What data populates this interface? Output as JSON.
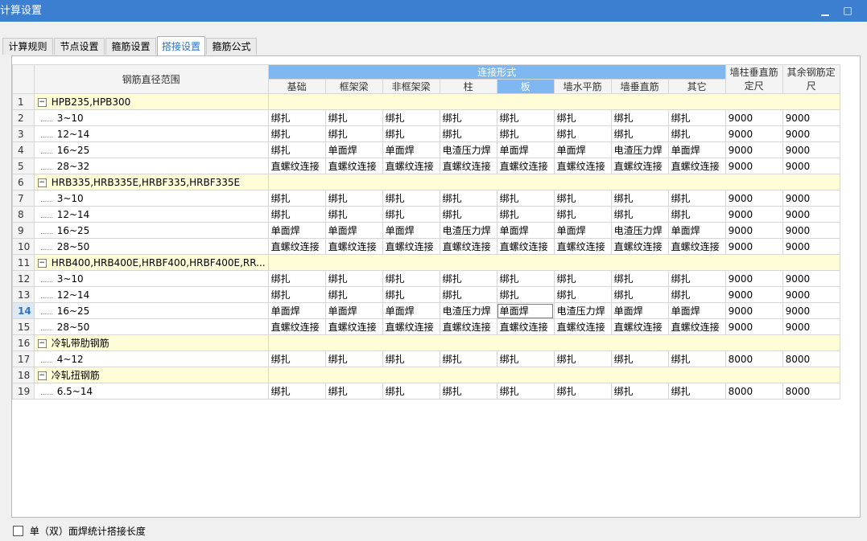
{
  "window": {
    "title": "计算设置",
    "minimize": "▁",
    "maximize": "□"
  },
  "tabs": [
    {
      "label": "计算规则",
      "active": false
    },
    {
      "label": "节点设置",
      "active": false
    },
    {
      "label": "箍筋设置",
      "active": false
    },
    {
      "label": "搭接设置",
      "active": true
    },
    {
      "label": "箍筋公式",
      "active": false
    }
  ],
  "table": {
    "header_range": "钢筋直径范围",
    "header_group": "连接形式",
    "columns": [
      "基础",
      "框架梁",
      "非框架梁",
      "柱",
      "板",
      "墙水平筋",
      "墙垂直筋",
      "其它"
    ],
    "col_wall_vertical_len": "墙柱垂直筋定尺",
    "col_other_len": "其余钢筋定尺",
    "rows": [
      {
        "num": "1",
        "group": true,
        "name": "HPB235,HPB300"
      },
      {
        "num": "2",
        "name": "3~10",
        "cells": [
          "绑扎",
          "绑扎",
          "绑扎",
          "绑扎",
          "绑扎",
          "绑扎",
          "绑扎",
          "绑扎",
          "9000",
          "9000"
        ]
      },
      {
        "num": "3",
        "name": "12~14",
        "cells": [
          "绑扎",
          "绑扎",
          "绑扎",
          "绑扎",
          "绑扎",
          "绑扎",
          "绑扎",
          "绑扎",
          "9000",
          "9000"
        ]
      },
      {
        "num": "4",
        "name": "16~25",
        "cells": [
          "绑扎",
          "单面焊",
          "单面焊",
          "电渣压力焊",
          "单面焊",
          "单面焊",
          "电渣压力焊",
          "单面焊",
          "9000",
          "9000"
        ]
      },
      {
        "num": "5",
        "name": "28~32",
        "cells": [
          "直螺纹连接",
          "直螺纹连接",
          "直螺纹连接",
          "直螺纹连接",
          "直螺纹连接",
          "直螺纹连接",
          "直螺纹连接",
          "直螺纹连接",
          "9000",
          "9000"
        ]
      },
      {
        "num": "6",
        "group": true,
        "name": "HRB335,HRB335E,HRBF335,HRBF335E"
      },
      {
        "num": "7",
        "name": "3~10",
        "cells": [
          "绑扎",
          "绑扎",
          "绑扎",
          "绑扎",
          "绑扎",
          "绑扎",
          "绑扎",
          "绑扎",
          "9000",
          "9000"
        ]
      },
      {
        "num": "8",
        "name": "12~14",
        "cells": [
          "绑扎",
          "绑扎",
          "绑扎",
          "绑扎",
          "绑扎",
          "绑扎",
          "绑扎",
          "绑扎",
          "9000",
          "9000"
        ]
      },
      {
        "num": "9",
        "name": "16~25",
        "cells": [
          "单面焊",
          "单面焊",
          "单面焊",
          "电渣压力焊",
          "单面焊",
          "单面焊",
          "电渣压力焊",
          "单面焊",
          "9000",
          "9000"
        ]
      },
      {
        "num": "10",
        "name": "28~50",
        "cells": [
          "直螺纹连接",
          "直螺纹连接",
          "直螺纹连接",
          "直螺纹连接",
          "直螺纹连接",
          "直螺纹连接",
          "直螺纹连接",
          "直螺纹连接",
          "9000",
          "9000"
        ]
      },
      {
        "num": "11",
        "group": true,
        "name": "HRB400,HRB400E,HRBF400,HRBF400E,RR..."
      },
      {
        "num": "12",
        "name": "3~10",
        "cells": [
          "绑扎",
          "绑扎",
          "绑扎",
          "绑扎",
          "绑扎",
          "绑扎",
          "绑扎",
          "绑扎",
          "9000",
          "9000"
        ]
      },
      {
        "num": "13",
        "name": "12~14",
        "cells": [
          "绑扎",
          "绑扎",
          "绑扎",
          "绑扎",
          "绑扎",
          "绑扎",
          "绑扎",
          "绑扎",
          "9000",
          "9000"
        ]
      },
      {
        "num": "14",
        "name": "16~25",
        "active": true,
        "cells": [
          "单面焊",
          "单面焊",
          "单面焊",
          "电渣压力焊",
          "单面焊",
          "电渣压力焊",
          "单面焊",
          "单面焊",
          "9000",
          "9000"
        ]
      },
      {
        "num": "15",
        "name": "28~50",
        "cells": [
          "直螺纹连接",
          "直螺纹连接",
          "直螺纹连接",
          "直螺纹连接",
          "直螺纹连接",
          "直螺纹连接",
          "直螺纹连接",
          "直螺纹连接",
          "9000",
          "9000"
        ]
      },
      {
        "num": "16",
        "group": true,
        "name": "冷轧带肋钢筋"
      },
      {
        "num": "17",
        "name": "4~12",
        "cells": [
          "绑扎",
          "绑扎",
          "绑扎",
          "绑扎",
          "绑扎",
          "绑扎",
          "绑扎",
          "绑扎",
          "8000",
          "8000"
        ]
      },
      {
        "num": "18",
        "group": true,
        "name": "冷轧扭钢筋"
      },
      {
        "num": "19",
        "name": "6.5~14",
        "cells": [
          "绑扎",
          "绑扎",
          "绑扎",
          "绑扎",
          "绑扎",
          "绑扎",
          "绑扎",
          "绑扎",
          "8000",
          "8000"
        ]
      }
    ]
  },
  "footer": {
    "checkbox_label": "单（双）面焊统计搭接长度",
    "checked": false
  },
  "colors": {
    "titlebar": "#3c7fd1",
    "header_group": "#7fb8f0",
    "group_row": "#fffdd8",
    "active_tab_text": "#2a73c6"
  }
}
